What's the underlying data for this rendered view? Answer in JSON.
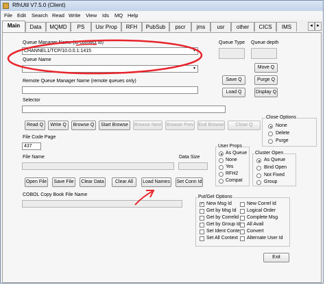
{
  "window": {
    "title": "RfhUtil V7.5.0 (Client)"
  },
  "menu": [
    "File",
    "Edit",
    "Search",
    "Read",
    "Write",
    "View",
    "Ids",
    "MQ",
    "Help"
  ],
  "tabs": [
    "Main",
    "Data",
    "MQMD",
    "PS",
    "Usr Prop",
    "RFH",
    "PubSub",
    "pscr",
    "jms",
    "usr",
    "other",
    "CICS",
    "IMS"
  ],
  "tab_arrows": {
    "left": "◄",
    "right": "►"
  },
  "main": {
    "qm_label": "Queue Manager Name (to connect to)",
    "qm_value": "CHANNEL1/TCP/10.0.0.1:1415",
    "queue_label": "Queue Name",
    "queue_value": "",
    "queue_type_label": "Queue Type",
    "queue_depth_label": "Queue depth",
    "remote_qm_label": "Remote Queue Manager Name (remote queues only)",
    "selector_label": "Selector",
    "file_code_page_label": "File Code Page",
    "file_code_page_value": "437",
    "file_name_label": "File Name",
    "data_size_label": "Data Size",
    "cobol_label": "COBOL Copy Book File Name"
  },
  "buttons": {
    "move_q": "Move Q",
    "save_q": "Save Q",
    "purge_q": "Purge Q",
    "load_q": "Load Q",
    "display_q": "Display Q",
    "read_q": "Read Q",
    "write_q": "Write Q",
    "browse_q": "Browse Q",
    "start_browse": "Start Browse",
    "browse_next": "Browse Next",
    "browse_prev": "Browse Prev",
    "end_browse": "End Browse",
    "close_q": "Close Q",
    "open_file": "Open File",
    "save_file": "Save File",
    "clear_data": "Clear Data",
    "clear_all": "Clear All",
    "load_names": "Load Names",
    "set_conn_id": "Set Conn Id",
    "exit": "Exit"
  },
  "close_options": {
    "title": "Close Options",
    "items": [
      "None",
      "Delete",
      "Purge"
    ],
    "selected": 0
  },
  "user_props": {
    "title": "User Props",
    "items": [
      "As Queue",
      "None",
      "Yes",
      "RFH2",
      "Compat"
    ],
    "selected": 0
  },
  "cluster_open": {
    "title": "Cluster Open",
    "items": [
      "As Queue",
      "Bind Open",
      "Not Fixed",
      "Group"
    ],
    "selected": 0
  },
  "put_get": {
    "title": "Put/Get Options",
    "left": [
      {
        "label": "New Msg Id",
        "checked": true
      },
      {
        "label": "Get by Msg Id",
        "checked": false
      },
      {
        "label": "Get by Correlid",
        "checked": false
      },
      {
        "label": "Get by Group Id",
        "checked": false
      },
      {
        "label": "Set Ident Context",
        "checked": false
      },
      {
        "label": "Set All Context",
        "checked": false
      }
    ],
    "right": [
      {
        "label": "New Correl Id",
        "checked": false
      },
      {
        "label": "Logical Order",
        "checked": false
      },
      {
        "label": "Complete Msg",
        "checked": false
      },
      {
        "label": "All Avail",
        "checked": false
      },
      {
        "label": "Convert",
        "checked": false
      },
      {
        "label": "Alternate User Id",
        "checked": false
      }
    ]
  },
  "colors": {
    "annotation": "#e8242c",
    "window_frame": "#7a8ea8"
  },
  "icons": {
    "app": "app-icon",
    "dropdown": "chevron-down-icon",
    "check": "check-icon"
  }
}
